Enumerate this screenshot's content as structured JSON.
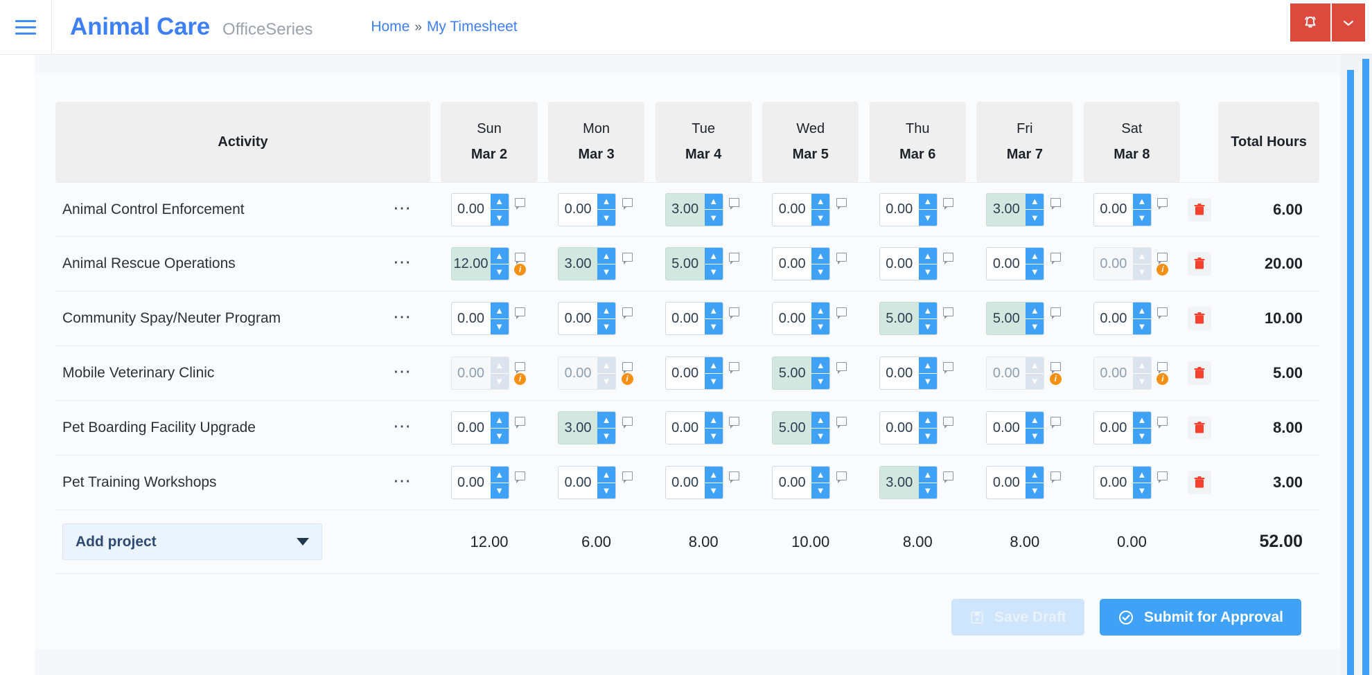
{
  "topbar": {
    "menu_icon": "hamburger-icon",
    "brand_title": "Animal Care",
    "brand_subtitle": "OfficeSeries",
    "breadcrumb": {
      "home": "Home",
      "separator": "»",
      "current": "My Timesheet"
    },
    "notification_icon": "bell-icon",
    "notification_caret_icon": "chevron-down-icon",
    "accent_red": "#dc4a3d",
    "accent_blue": "#3d7ff5"
  },
  "table": {
    "headers": {
      "activity": "Activity",
      "total": "Total Hours",
      "days": [
        {
          "name": "Sun",
          "date": "Mar 2"
        },
        {
          "name": "Mon",
          "date": "Mar 3"
        },
        {
          "name": "Tue",
          "date": "Mar 4"
        },
        {
          "name": "Wed",
          "date": "Mar 5"
        },
        {
          "name": "Thu",
          "date": "Mar 6"
        },
        {
          "name": "Fri",
          "date": "Mar 7"
        },
        {
          "name": "Sat",
          "date": "Mar 8"
        }
      ]
    },
    "rows": [
      {
        "activity": "Animal Control Enforcement",
        "menu_icon": "ellipsis-icon",
        "delete_icon": "trash-icon",
        "total": "6.00",
        "cells": [
          {
            "value": "0.00",
            "filled": false,
            "disabled": false,
            "info": false
          },
          {
            "value": "0.00",
            "filled": false,
            "disabled": false,
            "info": false
          },
          {
            "value": "3.00",
            "filled": true,
            "disabled": false,
            "info": false
          },
          {
            "value": "0.00",
            "filled": false,
            "disabled": false,
            "info": false
          },
          {
            "value": "0.00",
            "filled": false,
            "disabled": false,
            "info": false
          },
          {
            "value": "3.00",
            "filled": true,
            "disabled": false,
            "info": false
          },
          {
            "value": "0.00",
            "filled": false,
            "disabled": false,
            "info": false
          }
        ]
      },
      {
        "activity": "Animal Rescue Operations",
        "menu_icon": "ellipsis-icon",
        "delete_icon": "trash-icon",
        "total": "20.00",
        "cells": [
          {
            "value": "12.00",
            "filled": true,
            "disabled": false,
            "info": true
          },
          {
            "value": "3.00",
            "filled": true,
            "disabled": false,
            "info": false
          },
          {
            "value": "5.00",
            "filled": true,
            "disabled": false,
            "info": false
          },
          {
            "value": "0.00",
            "filled": false,
            "disabled": false,
            "info": false
          },
          {
            "value": "0.00",
            "filled": false,
            "disabled": false,
            "info": false
          },
          {
            "value": "0.00",
            "filled": false,
            "disabled": false,
            "info": false
          },
          {
            "value": "0.00",
            "filled": false,
            "disabled": true,
            "info": true
          }
        ]
      },
      {
        "activity": "Community Spay/Neuter Program",
        "menu_icon": "ellipsis-icon",
        "delete_icon": "trash-icon",
        "total": "10.00",
        "cells": [
          {
            "value": "0.00",
            "filled": false,
            "disabled": false,
            "info": false
          },
          {
            "value": "0.00",
            "filled": false,
            "disabled": false,
            "info": false
          },
          {
            "value": "0.00",
            "filled": false,
            "disabled": false,
            "info": false
          },
          {
            "value": "0.00",
            "filled": false,
            "disabled": false,
            "info": false
          },
          {
            "value": "5.00",
            "filled": true,
            "disabled": false,
            "info": false
          },
          {
            "value": "5.00",
            "filled": true,
            "disabled": false,
            "info": false
          },
          {
            "value": "0.00",
            "filled": false,
            "disabled": false,
            "info": false
          }
        ]
      },
      {
        "activity": "Mobile Veterinary Clinic",
        "menu_icon": "ellipsis-icon",
        "delete_icon": "trash-icon",
        "total": "5.00",
        "cells": [
          {
            "value": "0.00",
            "filled": false,
            "disabled": true,
            "info": true
          },
          {
            "value": "0.00",
            "filled": false,
            "disabled": true,
            "info": true
          },
          {
            "value": "0.00",
            "filled": false,
            "disabled": false,
            "info": false
          },
          {
            "value": "5.00",
            "filled": true,
            "disabled": false,
            "info": false
          },
          {
            "value": "0.00",
            "filled": false,
            "disabled": false,
            "info": false
          },
          {
            "value": "0.00",
            "filled": false,
            "disabled": true,
            "info": true
          },
          {
            "value": "0.00",
            "filled": false,
            "disabled": true,
            "info": true
          }
        ]
      },
      {
        "activity": "Pet Boarding Facility Upgrade",
        "menu_icon": "ellipsis-icon",
        "delete_icon": "trash-icon",
        "total": "8.00",
        "cells": [
          {
            "value": "0.00",
            "filled": false,
            "disabled": false,
            "info": false
          },
          {
            "value": "3.00",
            "filled": true,
            "disabled": false,
            "info": false
          },
          {
            "value": "0.00",
            "filled": false,
            "disabled": false,
            "info": false
          },
          {
            "value": "5.00",
            "filled": true,
            "disabled": false,
            "info": false
          },
          {
            "value": "0.00",
            "filled": false,
            "disabled": false,
            "info": false
          },
          {
            "value": "0.00",
            "filled": false,
            "disabled": false,
            "info": false
          },
          {
            "value": "0.00",
            "filled": false,
            "disabled": false,
            "info": false
          }
        ]
      },
      {
        "activity": "Pet Training Workshops",
        "menu_icon": "ellipsis-icon",
        "delete_icon": "trash-icon",
        "total": "3.00",
        "cells": [
          {
            "value": "0.00",
            "filled": false,
            "disabled": false,
            "info": false
          },
          {
            "value": "0.00",
            "filled": false,
            "disabled": false,
            "info": false
          },
          {
            "value": "0.00",
            "filled": false,
            "disabled": false,
            "info": false
          },
          {
            "value": "0.00",
            "filled": false,
            "disabled": false,
            "info": false
          },
          {
            "value": "3.00",
            "filled": true,
            "disabled": false,
            "info": false
          },
          {
            "value": "0.00",
            "filled": false,
            "disabled": false,
            "info": false
          },
          {
            "value": "0.00",
            "filled": false,
            "disabled": false,
            "info": false
          }
        ]
      }
    ],
    "footer": {
      "add_project_label": "Add project",
      "add_project_caret_icon": "chevron-down-icon",
      "day_totals": [
        "12.00",
        "6.00",
        "8.00",
        "10.00",
        "8.00",
        "8.00",
        "0.00"
      ],
      "grand_total": "52.00"
    }
  },
  "actions": {
    "save_draft_label": "Save Draft",
    "save_draft_icon": "floppy-disk-icon",
    "save_draft_disabled": true,
    "submit_label": "Submit for Approval",
    "submit_icon": "check-circle-icon"
  },
  "scrollbars": {
    "color": "#3fa2f7"
  }
}
